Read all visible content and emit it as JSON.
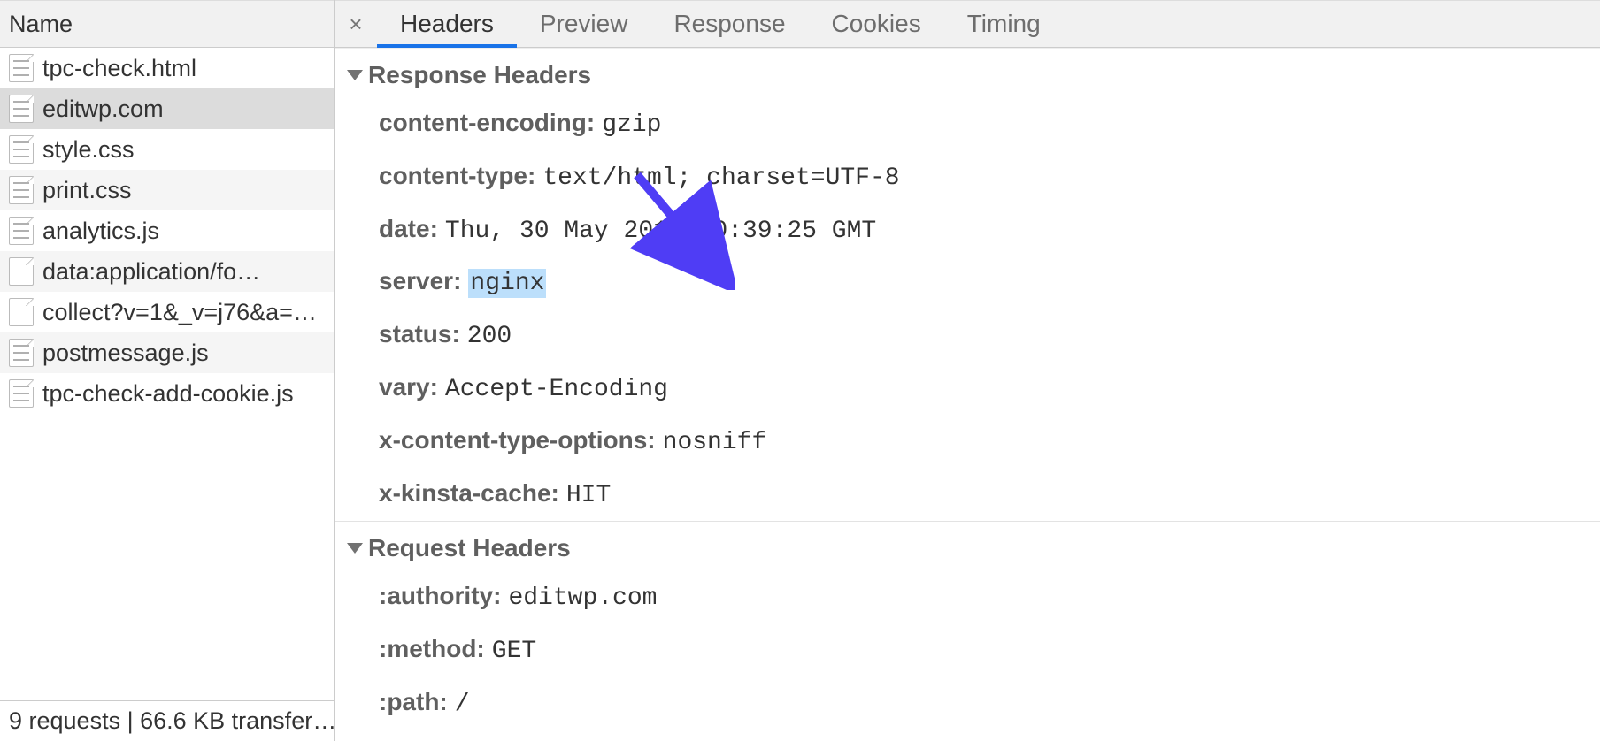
{
  "left": {
    "header": "Name",
    "requests": [
      {
        "label": "tpc-check.html",
        "iconType": "doc",
        "selected": false
      },
      {
        "label": "editwp.com",
        "iconType": "doc",
        "selected": true
      },
      {
        "label": "style.css",
        "iconType": "doc",
        "selected": false
      },
      {
        "label": "print.css",
        "iconType": "doc",
        "selected": false
      },
      {
        "label": "analytics.js",
        "iconType": "doc",
        "selected": false
      },
      {
        "label": "data:application/fo…",
        "iconType": "blank",
        "selected": false
      },
      {
        "label": "collect?v=1&_v=j76&a=…",
        "iconType": "blank",
        "selected": false
      },
      {
        "label": "postmessage.js",
        "iconType": "doc",
        "selected": false
      },
      {
        "label": "tpc-check-add-cookie.js",
        "iconType": "doc",
        "selected": false
      }
    ],
    "footer": "9 requests | 66.6 KB transfer…"
  },
  "tabs": {
    "close_glyph": "×",
    "items": [
      {
        "label": "Headers",
        "active": true
      },
      {
        "label": "Preview",
        "active": false
      },
      {
        "label": "Response",
        "active": false
      },
      {
        "label": "Cookies",
        "active": false
      },
      {
        "label": "Timing",
        "active": false
      }
    ]
  },
  "sections": {
    "responseHeaders": {
      "title": "Response Headers",
      "items": [
        {
          "name": "content-encoding:",
          "value": "gzip",
          "highlighted": false
        },
        {
          "name": "content-type:",
          "value": "text/html; charset=UTF-8",
          "highlighted": false
        },
        {
          "name": "date:",
          "value": "Thu, 30 May 2019 20:39:25 GMT",
          "highlighted": false
        },
        {
          "name": "server:",
          "value": "nginx",
          "highlighted": true
        },
        {
          "name": "status:",
          "value": "200",
          "highlighted": false
        },
        {
          "name": "vary:",
          "value": "Accept-Encoding",
          "highlighted": false
        },
        {
          "name": "x-content-type-options:",
          "value": "nosniff",
          "highlighted": false
        },
        {
          "name": "x-kinsta-cache:",
          "value": "HIT",
          "highlighted": false
        }
      ]
    },
    "requestHeaders": {
      "title": "Request Headers",
      "items": [
        {
          "name": ":authority:",
          "value": "editwp.com",
          "highlighted": false
        },
        {
          "name": ":method:",
          "value": "GET",
          "highlighted": false
        },
        {
          "name": ":path:",
          "value": "/",
          "highlighted": false
        }
      ]
    }
  },
  "annotation": {
    "arrow_color": "#4F3DF5"
  }
}
